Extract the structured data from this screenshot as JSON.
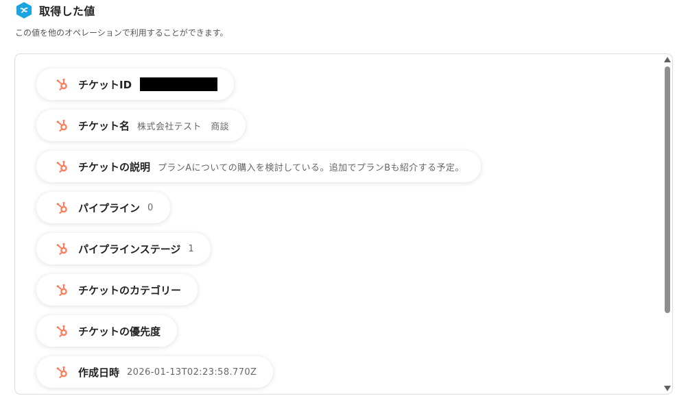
{
  "header": {
    "title": "取得した値",
    "subtitle": "この値を他のオペレーションで利用することができます。",
    "logo_icon": "yoom-logo",
    "accent_color": "#1aa4e0"
  },
  "fields": [
    {
      "label": "チケットID",
      "value": "",
      "redacted": true,
      "icon": "hubspot-icon"
    },
    {
      "label": "チケット名",
      "value": "株式会社テスト　商談",
      "icon": "hubspot-icon"
    },
    {
      "label": "チケットの説明",
      "value": "プランAについての購入を検討している。追加でプランBも紹介する予定。",
      "icon": "hubspot-icon"
    },
    {
      "label": "パイプライン",
      "value": "0",
      "icon": "hubspot-icon"
    },
    {
      "label": "パイプラインステージ",
      "value": "1",
      "icon": "hubspot-icon"
    },
    {
      "label": "チケットのカテゴリー",
      "value": "",
      "icon": "hubspot-icon"
    },
    {
      "label": "チケットの優先度",
      "value": "",
      "icon": "hubspot-icon"
    },
    {
      "label": "作成日時",
      "value": "2026-01-13T02:23:58.770Z",
      "icon": "hubspot-icon"
    }
  ],
  "colors": {
    "hubspot_orange": "#ff7a59",
    "scrollbar_thumb": "#8e8e8e"
  }
}
